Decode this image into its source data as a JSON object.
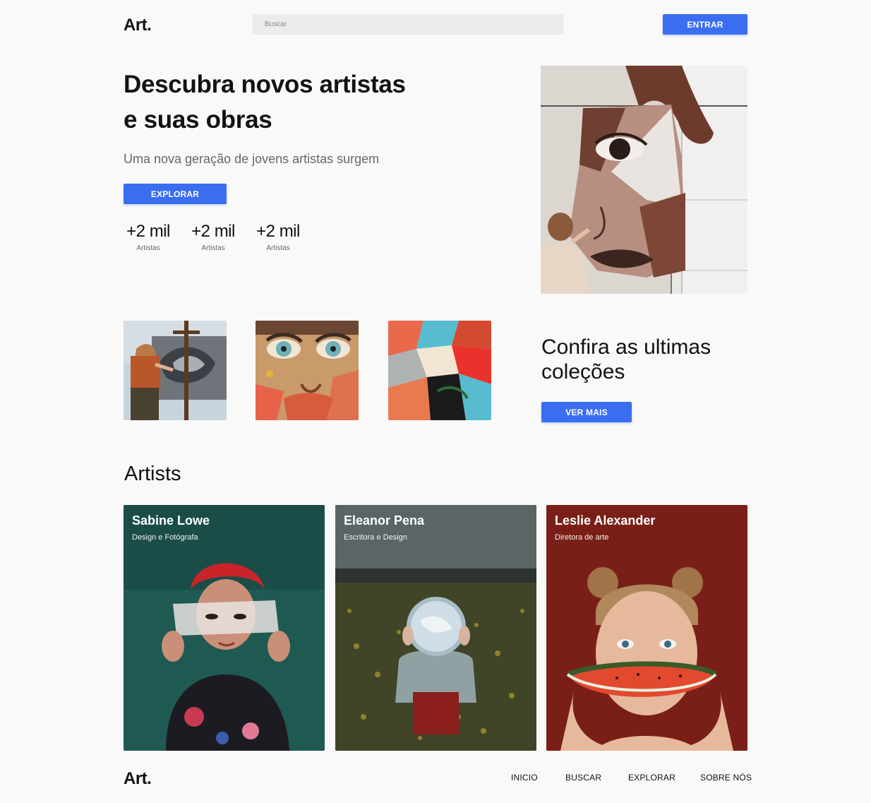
{
  "header": {
    "logo": "Art.",
    "search_placeholder": "Buscar",
    "login_label": "ENTRAR"
  },
  "hero": {
    "title_line1": "Descubra novos artistas",
    "title_line2": "e suas obras",
    "subtitle": "Uma nova geração de jovens artistas surgem",
    "explore_label": "EXPLORAR",
    "stats": [
      {
        "value": "+2 mil",
        "label": "Artistas"
      },
      {
        "value": "+2 mil",
        "label": "Artistas"
      },
      {
        "value": "+2 mil",
        "label": "Artistas"
      }
    ]
  },
  "collections": {
    "title": "Confira as ultimas coleções",
    "more_label": "VER MAIS"
  },
  "artists": {
    "title": "Artists",
    "cards": [
      {
        "name": "Sabine Lowe",
        "role": "Design e Fotógrafa",
        "bg": "#1e5a52"
      },
      {
        "name": "Eleanor Pena",
        "role": "Escritora e Design",
        "bg": "#3c4a47"
      },
      {
        "name": "Leslie Alexander",
        "role": "Diretora de arte",
        "bg": "#7a1f18"
      }
    ]
  },
  "footer": {
    "logo": "Art.",
    "nav": [
      "INICIO",
      "BUSCAR",
      "EXPLORAR",
      "SOBRE NÓS"
    ]
  },
  "colors": {
    "accent": "#3a6df0",
    "background": "#f9f9f9"
  }
}
